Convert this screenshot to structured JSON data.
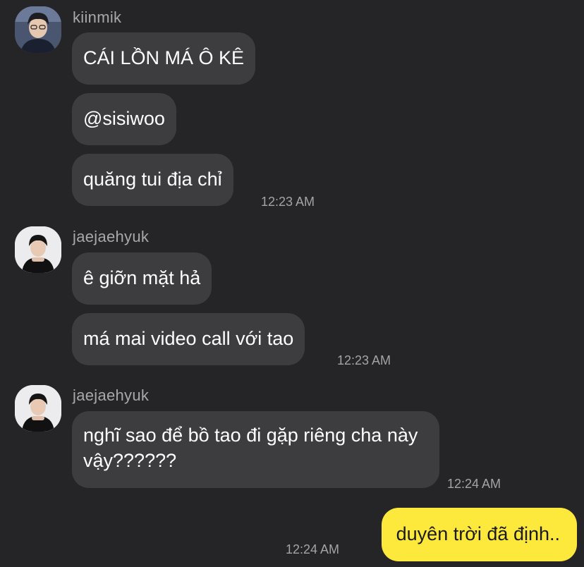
{
  "groups": [
    {
      "sender": "kiinmik",
      "avatar_icon": "user-avatar-icon",
      "messages": [
        "CÁI LỒN MÁ Ô KÊ",
        "@sisiwoo",
        "quăng tui địa chỉ"
      ],
      "time": "12:23 AM"
    },
    {
      "sender": "jaejaehyuk",
      "avatar_icon": "user-avatar-icon",
      "messages": [
        "ê giỡn mặt hả",
        "má mai video call với tao"
      ],
      "time": "12:23 AM"
    },
    {
      "sender": "jaejaehyuk",
      "avatar_icon": "user-avatar-icon",
      "messages": [
        "nghĩ sao để bồ tao đi gặp riêng cha này vậy??????"
      ],
      "time": "12:24 AM"
    }
  ],
  "outgoing": {
    "message": "duyên trời đã định..",
    "time": "12:24 AM"
  },
  "colors": {
    "background": "#252527",
    "incoming_bubble": "#3d3d40",
    "outgoing_bubble": "#fde83c"
  }
}
